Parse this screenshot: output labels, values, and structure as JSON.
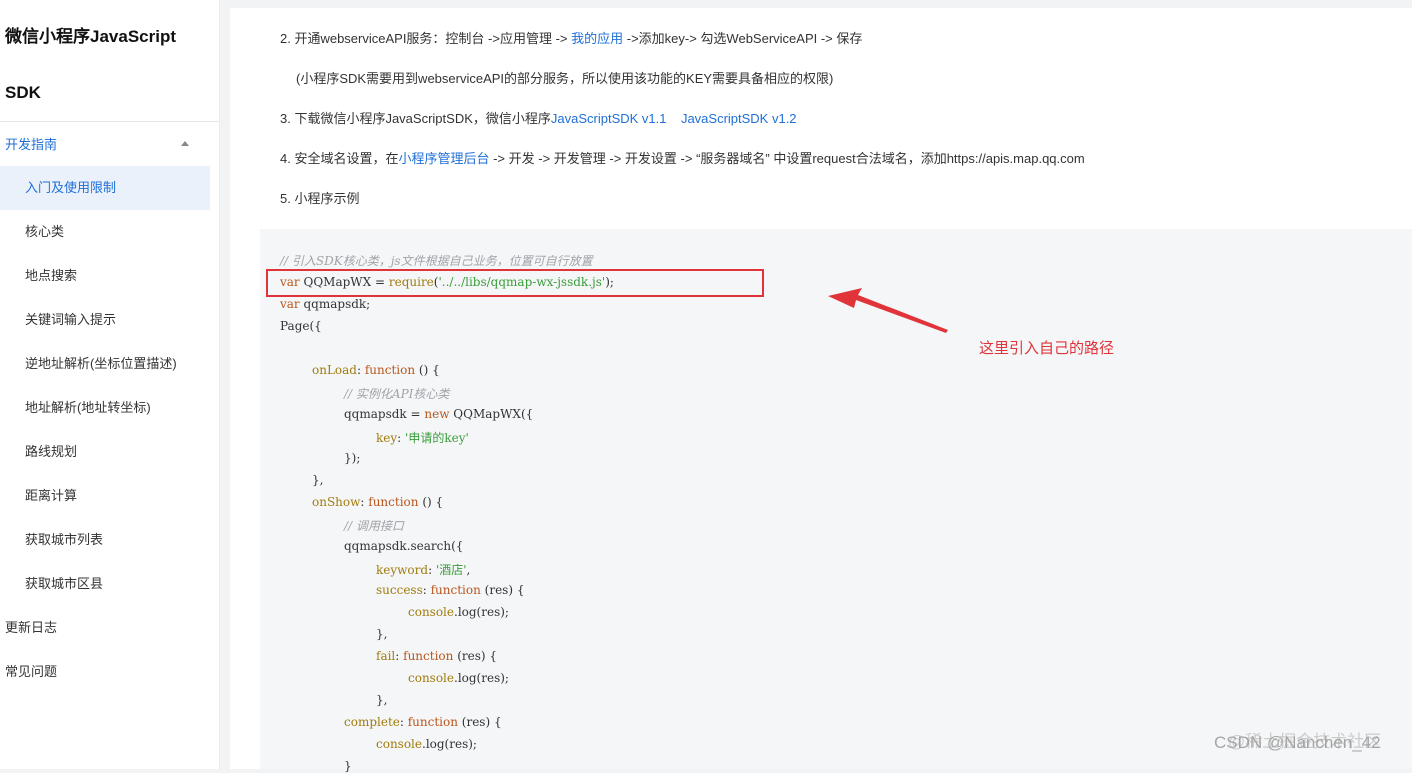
{
  "sidebar": {
    "title_line1": "微信小程序JavaScript",
    "title_line2": "SDK",
    "group_label": "开发指南",
    "items": [
      {
        "label": "入门及使用限制"
      },
      {
        "label": "核心类"
      },
      {
        "label": "地点搜索"
      },
      {
        "label": "关键词输入提示"
      },
      {
        "label": "逆地址解析(坐标位置描述)"
      },
      {
        "label": "地址解析(地址转坐标)"
      },
      {
        "label": "路线规划"
      },
      {
        "label": "距离计算"
      },
      {
        "label": "获取城市列表"
      },
      {
        "label": "获取城市区县"
      }
    ],
    "changelog": "更新日志",
    "faq": "常见问题"
  },
  "steps": {
    "s2": {
      "prefix": "2. 开通webserviceAPI服务：控制台 ->应用管理 -> ",
      "link": "我的应用",
      "suffix": " ->添加key-> 勾选WebServiceAPI -> 保存"
    },
    "s2_note": "(小程序SDK需要用到webserviceAPI的部分服务，所以使用该功能的KEY需要具备相应的权限)",
    "s3": {
      "prefix": "3. 下载微信小程序JavaScriptSDK，微信小程序",
      "link1": "JavaScriptSDK v1.1",
      "link2": "JavaScriptSDK v1.2"
    },
    "s4": {
      "prefix": "4. 安全域名设置，在",
      "link": "小程序管理后台",
      "suffix": " -> 开发 -> 开发管理 -> 开发设置 -> “服务器域名” 中设置request合法域名，添加https://apis.map.qq.com"
    },
    "s5": "5. 小程序示例"
  },
  "code": {
    "l1": "// 引入SDK核心类，js文件根据自己业务，位置可自行放置",
    "l2_kw": "var",
    "l2_mid": " QQMapWX = ",
    "l2_fn": "require",
    "l2_str": "'../../libs/qqmap-wx-jssdk.js'",
    "l2_end": ");",
    "l3_kw": "var",
    "l3_rest": " qqmapsdk;",
    "l4": "Page({",
    "l5_prop": "onLoad",
    "l5_colon": ": ",
    "l5_kw": "function",
    "l5_rest": " () {",
    "l6": "// 实例化API核心类",
    "l7_pre": "qqmapsdk = ",
    "l7_kw": "new",
    "l7_rest": " QQMapWX({",
    "l8_prop": "key",
    "l8_colon": ": ",
    "l8_str": "'申请的key'",
    "l9": "});",
    "l10": "},",
    "l11_prop": "onShow",
    "l11_colon": ": ",
    "l11_kw": "function",
    "l11_rest": " () {",
    "l12": "// 调用接口",
    "l13": "qqmapsdk.search({",
    "l14_prop": "keyword",
    "l14_colon": ": ",
    "l14_str": "'酒店'",
    "l14_end": ",",
    "l15_prop": "success",
    "l15_colon": ": ",
    "l15_kw": "function",
    "l15_rest": " (res) {",
    "l16_fn": "console",
    "l16_rest": ".log(res);",
    "l17": "},",
    "l18_prop": "fail",
    "l18_colon": ": ",
    "l18_kw": "function",
    "l18_rest": " (res) {",
    "l19_fn": "console",
    "l19_rest": ".log(res);",
    "l20": "},",
    "l21_prop": "complete",
    "l21_colon": ": ",
    "l21_kw": "function",
    "l21_rest": " (res) {",
    "l22_fn": "console",
    "l22_rest": ".log(res);",
    "l23": "}"
  },
  "annotation": {
    "text": "这里引入自己的路径",
    "color": "#e0343a"
  },
  "watermark": {
    "line1": "@稀土掘金技术社区",
    "line2": "CSDN @Nanchen_42"
  }
}
